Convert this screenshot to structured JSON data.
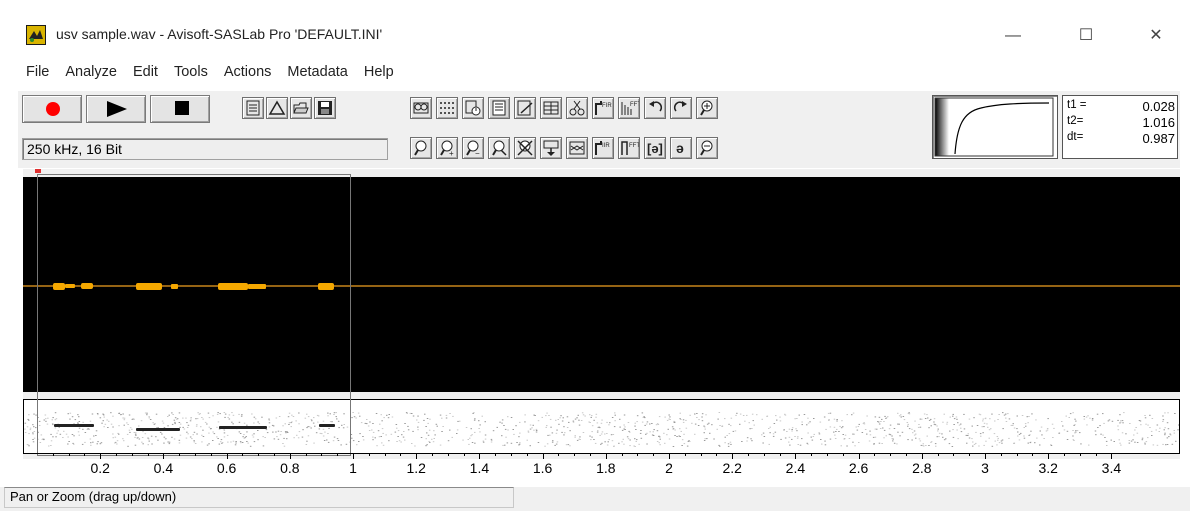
{
  "window": {
    "title": "usv sample.wav - Avisoft-SASLab Pro  'DEFAULT.INI'",
    "minimize": "—",
    "maximize": "☐",
    "close": "✕"
  },
  "menu": [
    "File",
    "Analyze",
    "Edit",
    "Tools",
    "Actions",
    "Metadata",
    "Help"
  ],
  "transport": {
    "record_icon": "record-icon",
    "play_icon": "play-icon",
    "stop_icon": "stop-icon"
  },
  "format_info": "250 kHz, 16 Bit",
  "toolbar_icons": {
    "file_group": [
      "file-info-icon",
      "triangle-icon",
      "open-folder-icon",
      "save-icon"
    ],
    "row1": [
      "reel-icon",
      "grid-icon",
      "clock-icon",
      "document-icon",
      "edit-icon",
      "table-icon",
      "scissors-icon",
      "fir-filter-icon",
      "fft-filter-icon",
      "undo-icon",
      "redo-icon",
      "zoom-in-plus-icon"
    ],
    "row2": [
      "zoom-icon",
      "zoom-plus-icon",
      "zoom-minus-icon",
      "zoom-range-icon",
      "delete-icon",
      "insert-icon",
      "envelope-icon",
      "iir-filter-icon",
      "fft-icon",
      "bracket-icon",
      "reverse-icon",
      "zoom-out-minus-icon"
    ]
  },
  "time_readout": {
    "t1_label": "t1 =",
    "t1_value": "0.028",
    "t2_label": "t2=",
    "t2_value": "1.016",
    "dt_label": "dt=",
    "dt_value": "0.987"
  },
  "axis": {
    "ticks": [
      "0.2",
      "0.4",
      "0.6",
      "0.8",
      "1",
      "1.2",
      "1.4",
      "1.6",
      "1.8",
      "2",
      "2.2",
      "2.4",
      "2.6",
      "2.8",
      "3",
      "3.2",
      "3.4"
    ]
  },
  "colors": {
    "waveform": "#f5a800",
    "record": "#ff0000",
    "background": "#000000"
  },
  "status": "Pan or Zoom (drag up/down)"
}
